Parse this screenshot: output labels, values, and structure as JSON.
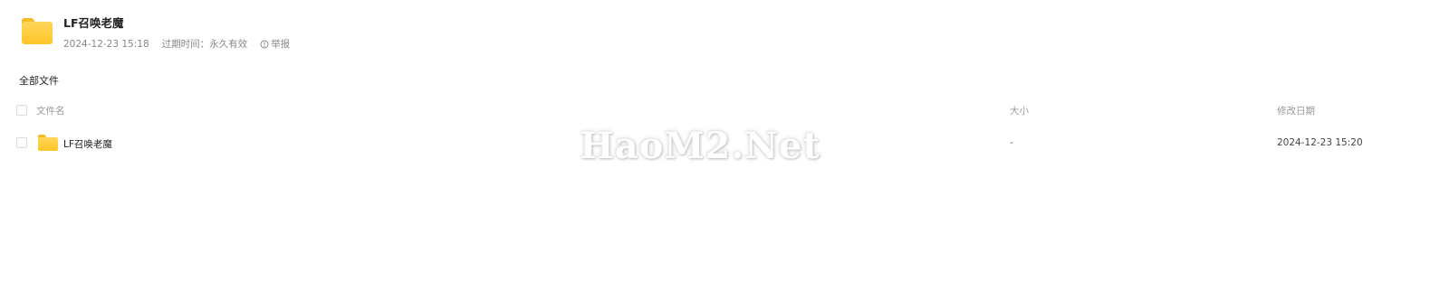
{
  "share": {
    "title": "LF召唤老魔",
    "date": "2024-12-23 15:18",
    "expiry": "过期时间：永久有效",
    "report_label": "举报",
    "icons": {
      "folder": "folder-icon",
      "report": "report-icon"
    }
  },
  "breadcrumb": {
    "root": "全部文件"
  },
  "table": {
    "headers": {
      "name": "文件名",
      "size": "大小",
      "modified": "修改日期"
    },
    "rows": [
      {
        "name": "LF召唤老魔",
        "size": "-",
        "modified": "2024-12-23 15:20",
        "icon": "folder-icon"
      }
    ]
  },
  "watermark": {
    "text": "HaoM2.Net"
  },
  "colors": {
    "folder": "#ffc426",
    "folder_tab": "#f7b82a",
    "muted_text": "#999999"
  }
}
